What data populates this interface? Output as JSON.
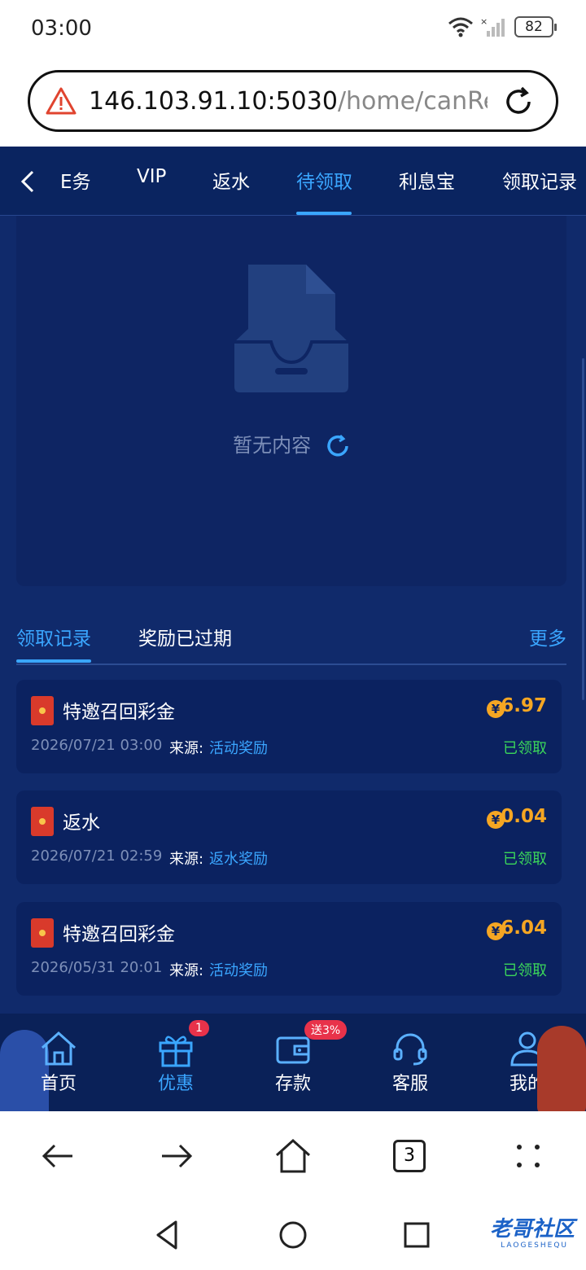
{
  "status_bar": {
    "time": "03:00",
    "battery": "82"
  },
  "url_bar": {
    "url_host": "146.103.91.10:5030",
    "url_path": "/home/canRec"
  },
  "tabs": [
    {
      "label": "E务",
      "active": false
    },
    {
      "label": "VIP",
      "active": false
    },
    {
      "label": "返水",
      "active": false
    },
    {
      "label": "待领取",
      "active": true
    },
    {
      "label": "利息宝",
      "active": false
    },
    {
      "label": "领取记录",
      "active": false
    }
  ],
  "empty_state": {
    "text": "暂无内容"
  },
  "record_tabs": {
    "received": "领取记录",
    "expired": "奖励已过期",
    "more": "更多"
  },
  "records": [
    {
      "title": "特邀召回彩金",
      "coin": "¥",
      "amount": "6.97",
      "date": "2026/07/21 03:00",
      "source_label": "来源:",
      "source_value": "活动奖励",
      "status": "已领取"
    },
    {
      "title": "返水",
      "coin": "¥",
      "amount": "0.04",
      "date": "2026/07/21 02:59",
      "source_label": "来源:",
      "source_value": "返水奖励",
      "status": "已领取"
    },
    {
      "title": "特邀召回彩金",
      "coin": "¥",
      "amount": "6.04",
      "date": "2026/05/31 20:01",
      "source_label": "来源:",
      "source_value": "活动奖励",
      "status": "已领取"
    }
  ],
  "bottom_nav": {
    "home": "首页",
    "promo": "优惠",
    "promo_badge": "1",
    "deposit": "存款",
    "deposit_badge": "送3%",
    "service": "客服",
    "mine": "我的"
  },
  "browser_nav": {
    "tab_count": "3"
  },
  "watermark": {
    "title": "老哥社区",
    "sub": "LAOGESHEQU"
  },
  "colors": {
    "accent": "#3aa6ff",
    "background": "#102a6b",
    "amount": "#f5a623",
    "status": "#3bd65a",
    "badge": "#e8324a"
  }
}
